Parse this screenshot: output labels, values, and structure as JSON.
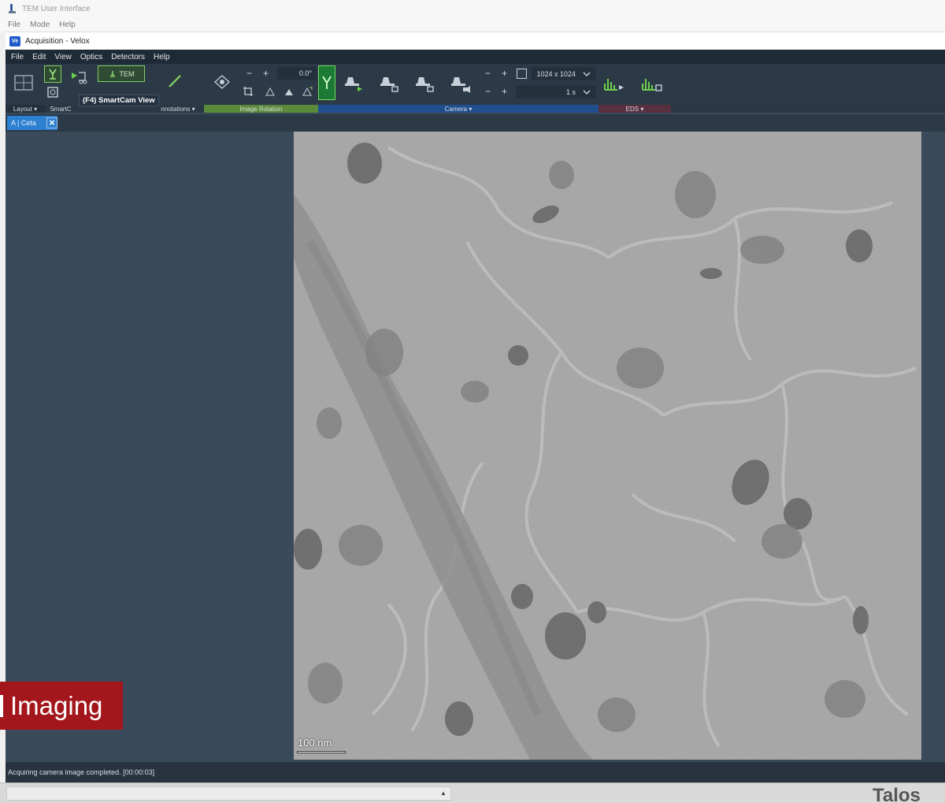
{
  "outer_window": {
    "title": "TEM User Interface",
    "menu": [
      "File",
      "Mode",
      "Help"
    ]
  },
  "velox_window": {
    "app_badge": "Ve",
    "title": "Acquisition - Velox",
    "menu": [
      "File",
      "Edit",
      "View",
      "Optics",
      "Detectors",
      "Help"
    ]
  },
  "ribbon": {
    "tem_button": "TEM",
    "rotation_value": "0.0°",
    "frame_size": "1024 x 1024",
    "exposure_time": "1 s",
    "tooltip": "(F4) SmartCam View",
    "groups": {
      "layout": "Layout ▾",
      "smartcam": "SmartC",
      "annotations": "nnotations ▾",
      "image_rotation": "Image Rotation",
      "camera": "Camera ▾",
      "eds": "EDS ▾"
    },
    "colors": {
      "image_rotation_group": "#5a8a3a",
      "camera_group": "#1f4f8f",
      "eds_group": "#5a3040",
      "active_green": "#75db5a"
    }
  },
  "tabs": [
    {
      "label": "A | Ceta"
    }
  ],
  "image": {
    "scale_bar": "100 nm"
  },
  "status": {
    "text": "Acquiring camera image completed. [00:00:03]"
  },
  "overlay": {
    "caption": "Imaging",
    "brand": "Talos"
  }
}
